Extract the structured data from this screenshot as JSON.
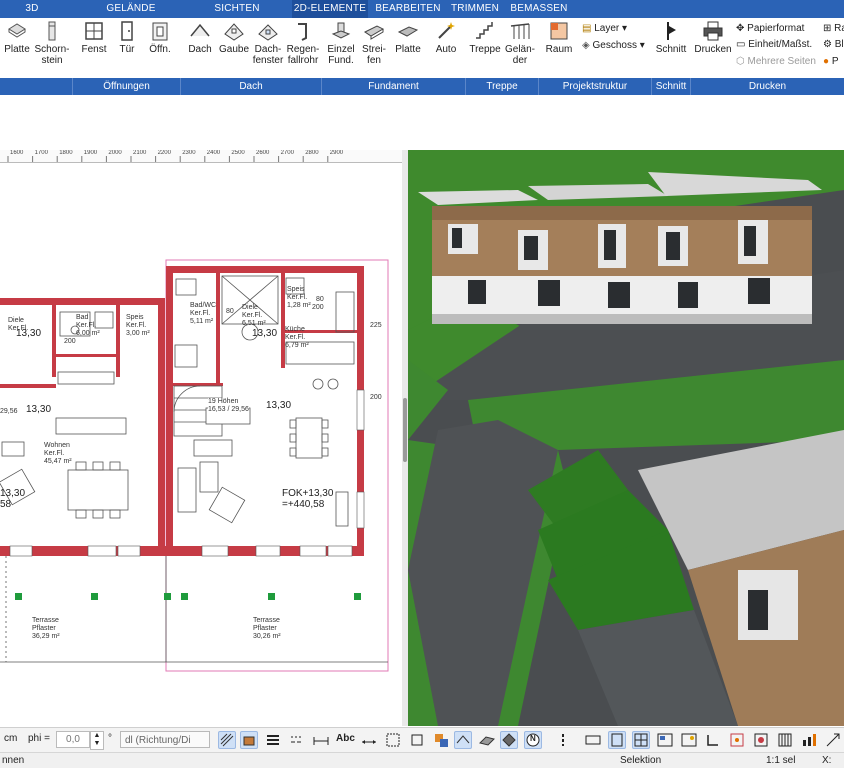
{
  "tabs": {
    "t3d": "3D",
    "gelaende": "GELÄNDE",
    "sichten": "SICHTEN",
    "elemente2d": "2D-ELEMENTE",
    "bearbeiten": "BEARBEITEN",
    "trimmen": "TRIMMEN",
    "bemassen": "BEMASSEN"
  },
  "ribbon": {
    "platte1": "Platte",
    "schornstein1": "Schorn-",
    "schornstein2": "stein",
    "fenst": "Fenst",
    "tuer": "Tür",
    "oeffn": "Öffn.",
    "dach": "Dach",
    "gaube": "Gaube",
    "dachfenster1": "Dach-",
    "dachfenster2": "fenster",
    "regenfall1": "Regen-",
    "regenfall2": "fallrohr",
    "einzel1": "Einzel",
    "einzel2": "Fund.",
    "streifen1": "Strei-",
    "streifen2": "fen",
    "platte2": "Platte",
    "auto": "Auto",
    "treppe": "Treppe",
    "gelaender1": "Gelän-",
    "gelaender2": "der",
    "raum": "Raum",
    "layer": "Layer ▾",
    "geschoss": "Geschoss ▾",
    "schnitt": "Schnitt",
    "drucken": "Drucken",
    "papierformat": "Papierformat",
    "einheit": "Einheit/Maßst.",
    "mehrere": "Mehrere Seiten",
    "ra": "Ra",
    "bl": "Bl",
    "p": "P"
  },
  "groups": {
    "oeffnungen": "Öffnungen",
    "dach": "Dach",
    "fundament": "Fundament",
    "treppe": "Treppe",
    "projektstruktur": "Projektstruktur",
    "schnitt": "Schnitt",
    "drucken": "Drucken"
  },
  "ruler": [
    "1600",
    "1700",
    "1800",
    "1900",
    "2000",
    "2100",
    "2200",
    "2300",
    "2400",
    "2500",
    "2600",
    "2700",
    "2800",
    "2900"
  ],
  "plan": {
    "diele_l": "Diele",
    "diele_l_sub": "Ker.Fl.",
    "bad_l": "Bad",
    "bad_l_sub": "Ker.Fl.",
    "bad_l_area": "6,00 m²",
    "speis_l": "Speis",
    "speis_l_sub": "Ker.Fl.",
    "speis_l_area": "3,00 m²",
    "lvl_1": "13,30",
    "lvl_2": "13,30",
    "lvl_3": "13,30",
    "lvl_4": "13,30",
    "wohnen": "Wohnen",
    "wohnen_sub": "Ker.Fl.",
    "wohnen_area": "45,47 m²",
    "badwc_r": "Bad/WC",
    "badwc_r_sub": "Ker.Fl.",
    "badwc_r_area": "5,11 m²",
    "diele_r": "Diele",
    "diele_r_sub": "Ker.Fl.",
    "diele_r_area": "6,51 m²",
    "speis_r": "Speis",
    "speis_r_sub": "Ker.Fl.",
    "speis_r_area": "1,28 m²",
    "kueche": "Küche",
    "kueche_sub": "Ker.Fl.",
    "kueche_area": "6,79 m²",
    "stairs": "19 Höhen",
    "stairs_dim": "16,53 / 29,56",
    "stairs_dim_l": "29,56",
    "fok": "FOK+13,30",
    "fok2": "=+440,58",
    "lvl_l": "13,30",
    "lvl_l2": "58",
    "terr_l": "Terrasse",
    "terr_l_sub": "Pflaster",
    "terr_l_area": "36,29 m²",
    "terr_r": "Terrasse",
    "terr_r_sub": "Pflaster",
    "terr_r_area": "30,26 m²",
    "dim_225": "225",
    "dim_200": "200",
    "dim_200b": "200",
    "dim_80": "80",
    "dim_80b": "80",
    "dim_200c": "200"
  },
  "bottom": {
    "unit": "cm",
    "phi_label": "phi =",
    "phi_value": "0,0",
    "deg": "°",
    "dl": "dl (Richtung/Di",
    "abc": "Abc",
    "n": "N"
  },
  "status": {
    "left": "nnen",
    "mode": "Selektion",
    "scale": "1:1 sel",
    "x": "X:"
  },
  "colors": {
    "tabbar": "#2b63b6",
    "wall": "#c63b45",
    "grass": "#3f8a2d",
    "road": "#4a4d50"
  }
}
